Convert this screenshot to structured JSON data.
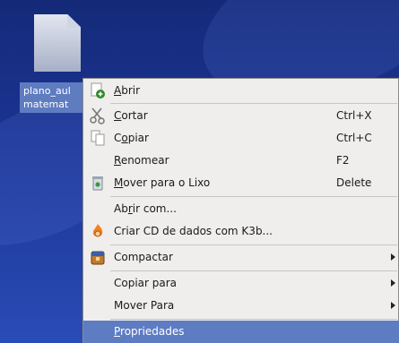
{
  "desktop": {
    "file_label_line1": "plano_aul",
    "file_label_line2": "matemat"
  },
  "context_menu": {
    "items": [
      {
        "label_pre": "",
        "label_ul": "A",
        "label_post": "brir",
        "shortcut": "",
        "icon": "open-icon"
      },
      {
        "label_pre": "",
        "label_ul": "C",
        "label_post": "ortar",
        "shortcut": "Ctrl+X",
        "icon": "cut-icon"
      },
      {
        "label_pre": "C",
        "label_ul": "o",
        "label_post": "piar",
        "shortcut": "Ctrl+C",
        "icon": "copy-icon"
      },
      {
        "label_pre": "",
        "label_ul": "R",
        "label_post": "enomear",
        "shortcut": "F2",
        "icon": ""
      },
      {
        "label_pre": "",
        "label_ul": "M",
        "label_post": "over para o Lixo",
        "shortcut": "Delete",
        "icon": "trash-icon"
      },
      {
        "label_pre": "Ab",
        "label_ul": "r",
        "label_post": "ir com...",
        "shortcut": "",
        "icon": ""
      },
      {
        "label_pre": "",
        "label_ul": "",
        "label_post": "Criar CD de dados com K3b...",
        "shortcut": "",
        "icon": "k3b-icon"
      },
      {
        "label_pre": "",
        "label_ul": "",
        "label_post": "Compactar",
        "shortcut": "",
        "icon": "archive-icon"
      },
      {
        "label_pre": "",
        "label_ul": "",
        "label_post": "Copiar para",
        "shortcut": "",
        "icon": ""
      },
      {
        "label_pre": "",
        "label_ul": "",
        "label_post": "Mover Para",
        "shortcut": "",
        "icon": ""
      },
      {
        "label_pre": "",
        "label_ul": "P",
        "label_post": "ropriedades",
        "shortcut": "",
        "icon": ""
      }
    ]
  },
  "colors": {
    "menu_bg": "#f0eeec",
    "highlight": "#5e7cc2",
    "desktop": "#1c3596"
  }
}
